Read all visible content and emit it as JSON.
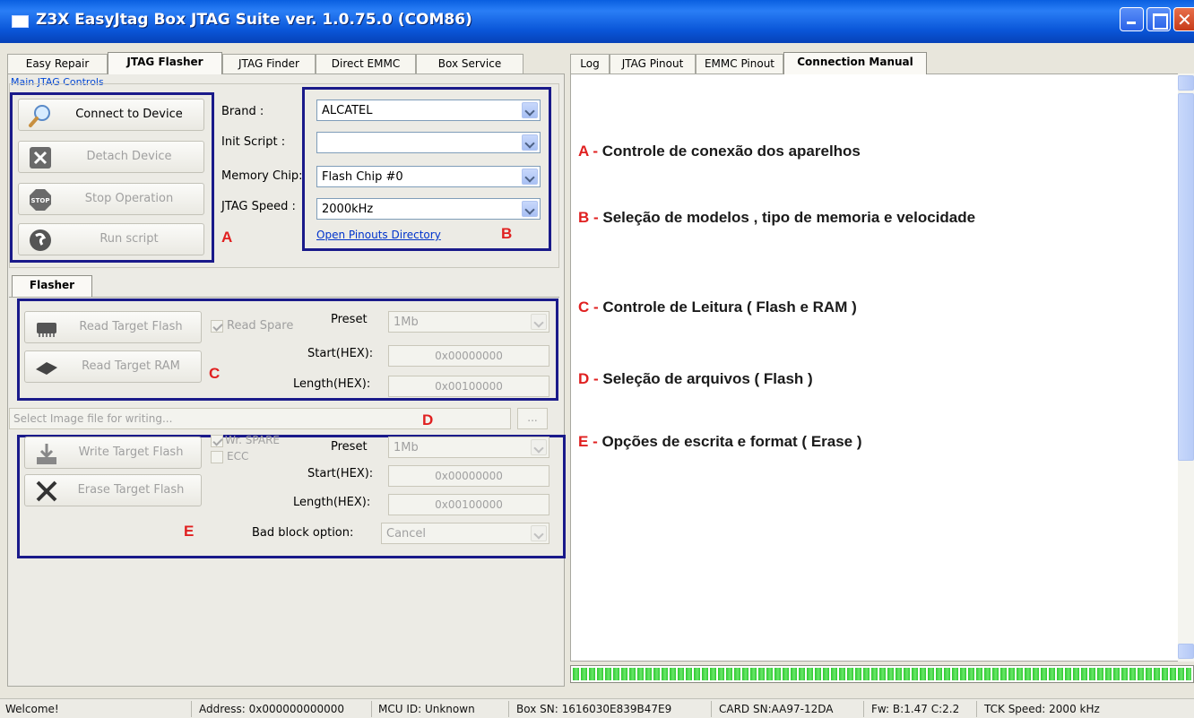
{
  "window": {
    "title": "Z3X EasyJtag Box JTAG Suite ver. 1.0.75.0 (COM86)",
    "close_glyph": "✕"
  },
  "left_tabs": [
    "Easy Repair",
    "JTAG Flasher",
    "JTAG Finder",
    "Direct EMMC",
    "Box Service"
  ],
  "left_active_tab": "JTAG Flasher",
  "right_tabs": [
    "Log",
    "JTAG Pinout",
    "EMMC Pinout",
    "Connection Manual"
  ],
  "right_active_tab": "Connection Manual",
  "main_controls": {
    "group_label": "Main JTAG Controls",
    "connect": "Connect to Device",
    "detach": "Detach Device",
    "stop": "Stop Operation",
    "run": "Run script",
    "brand_label": "Brand :",
    "brand_value": "ALCATEL",
    "init_label": "Init Script :",
    "init_value": "",
    "memory_label": "Memory Chip:",
    "memory_value": "Flash Chip #0",
    "speed_label": "JTAG Speed :",
    "speed_value": "2000kHz",
    "pinouts_link": "Open Pinouts Directory"
  },
  "flasher": {
    "tab_label": "Flasher",
    "read_flash": "Read Target Flash",
    "read_ram": "Read Target RAM",
    "read_spare": "Read Spare",
    "preset_label": "Preset",
    "preset_value": "1Mb",
    "start_label": "Start(HEX):",
    "start_value": "0x00000000",
    "length_label": "Length(HEX):",
    "length_value": "0x00100000",
    "file_placeholder": "Select Image file for writing...",
    "browse": "...",
    "write_flash": "Write Target Flash",
    "erase_flash": "Erase Target Flash",
    "wr_spare": "Wr. SPARE",
    "ecc": "ECC",
    "preset2_value": "1Mb",
    "start2_value": "0x00000000",
    "length2_value": "0x00100000",
    "bad_block_label": "Bad block option:",
    "bad_block_value": "Cancel"
  },
  "annotations": {
    "A": "A",
    "B": "B",
    "C": "C",
    "D": "D",
    "E": "E"
  },
  "manual": [
    {
      "letter": "A",
      "sep": " - ",
      "text": "Controle de conexão dos aparelhos"
    },
    {
      "letter": "B",
      "sep": " - ",
      "text": " Seleção de modelos , tipo de memoria e velocidade"
    },
    {
      "letter": "C",
      "sep": " - ",
      "text": "  Controle de Leitura ( Flash e RAM )"
    },
    {
      "letter": "D",
      "sep": " - ",
      "text": "  Seleção de arquivos ( Flash  )"
    },
    {
      "letter": "E",
      "sep": " - ",
      "text": "  Opções de escrita e format ( Erase )"
    }
  ],
  "progress": 1.0,
  "status": {
    "welcome": "Welcome!",
    "address": "Address: 0x000000000000",
    "mcu": "MCU ID: Unknown",
    "box_sn": "Box SN: 1616030E839B47E9",
    "card_sn": "CARD SN:AA97-12DA",
    "fw": "Fw: B:1.47 C:2.2",
    "tck": "TCK Speed: 2000 kHz"
  },
  "colors": {
    "annotation_red": "#e02020",
    "annotation_box": "#1a1a8a",
    "titlebar": "#0a5fe0",
    "progress_green": "#2ec830"
  }
}
